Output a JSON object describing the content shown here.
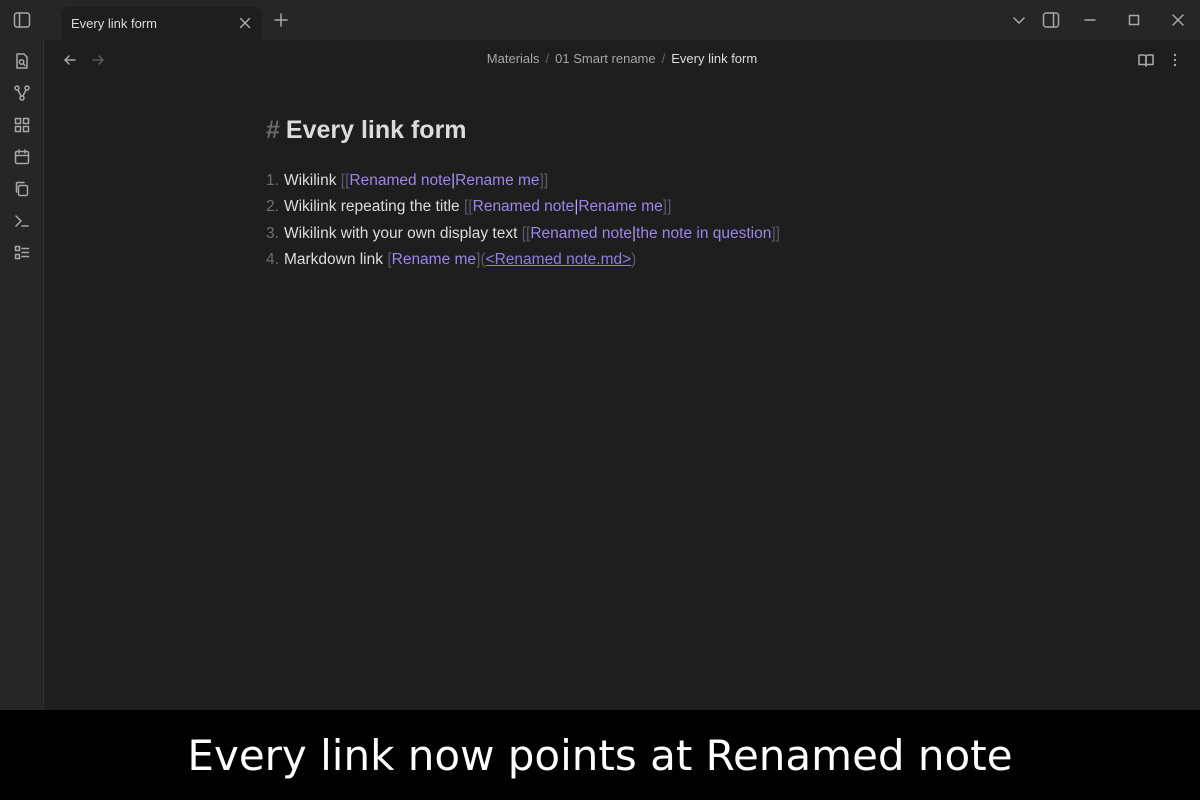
{
  "tabs": [
    {
      "title": "Every link form"
    }
  ],
  "breadcrumb": {
    "parts": [
      "Materials",
      "01 Smart rename"
    ],
    "current": "Every link form",
    "separator": "/"
  },
  "note": {
    "heading_marker": "#",
    "heading": "Every link form",
    "items": [
      {
        "num": "1.",
        "text": "Wikilink",
        "open": "[[",
        "target": "Renamed note",
        "pipe": "|",
        "display": "Rename me",
        "close": "]]"
      },
      {
        "num": "2.",
        "text": "Wikilink repeating the title",
        "open": "[[",
        "target": "Renamed note",
        "pipe": "|",
        "display": "Rename me",
        "close": "]]"
      },
      {
        "num": "3.",
        "text": "Wikilink with your own display text",
        "open": "[[",
        "target": "Renamed note",
        "pipe": "|",
        "display": "the note in question",
        "close": "]]"
      },
      {
        "num": "4.",
        "text": "Markdown link",
        "lb": "[",
        "label": "Rename me",
        "rb": "]",
        "lp": "(",
        "url": "<Renamed note.md>",
        "rp": ")"
      }
    ]
  },
  "caption": "Every link now points at Renamed note",
  "icons": {
    "titlebar": [
      "sidebar-toggle-icon",
      "close-icon",
      "plus-icon",
      "chevron-down-icon",
      "right-sidebar-icon",
      "minimize-icon",
      "maximize-icon",
      "window-close-icon"
    ],
    "ribbon": [
      "file-search-icon",
      "graph-icon",
      "blocks-icon",
      "calendar-icon",
      "copy-icon",
      "terminal-icon",
      "list-checks-icon"
    ],
    "nav": [
      "back-arrow-icon",
      "forward-arrow-icon",
      "reading-view-icon",
      "more-options-icon"
    ]
  },
  "colors": {
    "background": "#1e1e1e",
    "chrome": "#262626",
    "link": "#9a87ea",
    "caption_bg": "#000000"
  }
}
